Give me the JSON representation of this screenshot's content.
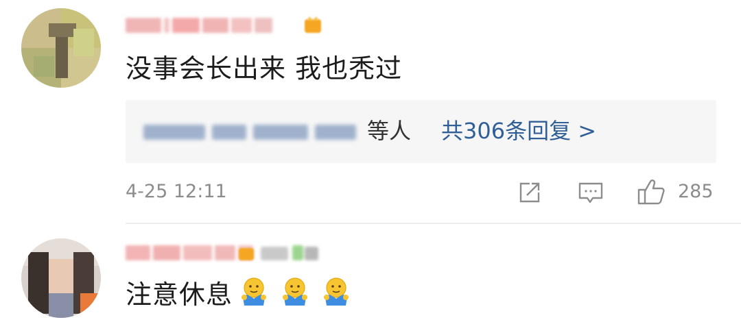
{
  "comments": [
    {
      "text": "没事会长出来 我也秃过",
      "reply_summary": {
        "suffix": "等人",
        "link": "共306条回复 >"
      },
      "timestamp": "4-25 12:11",
      "actions": {
        "share_icon": "share-arrow-icon",
        "comment_icon": "comment-bubble-icon",
        "like_icon": "thumbs-up-icon",
        "like_count": "285"
      }
    },
    {
      "text": "注意休息",
      "emoji_count": 3,
      "emoji_icon": "hug-emoji-icon"
    }
  ],
  "colors": {
    "link": "#2f5f96",
    "meta": "#8c8c8c",
    "reply_bg": "#f6f6f6",
    "divider": "#ececec",
    "vip_badge": "#f5a623"
  }
}
